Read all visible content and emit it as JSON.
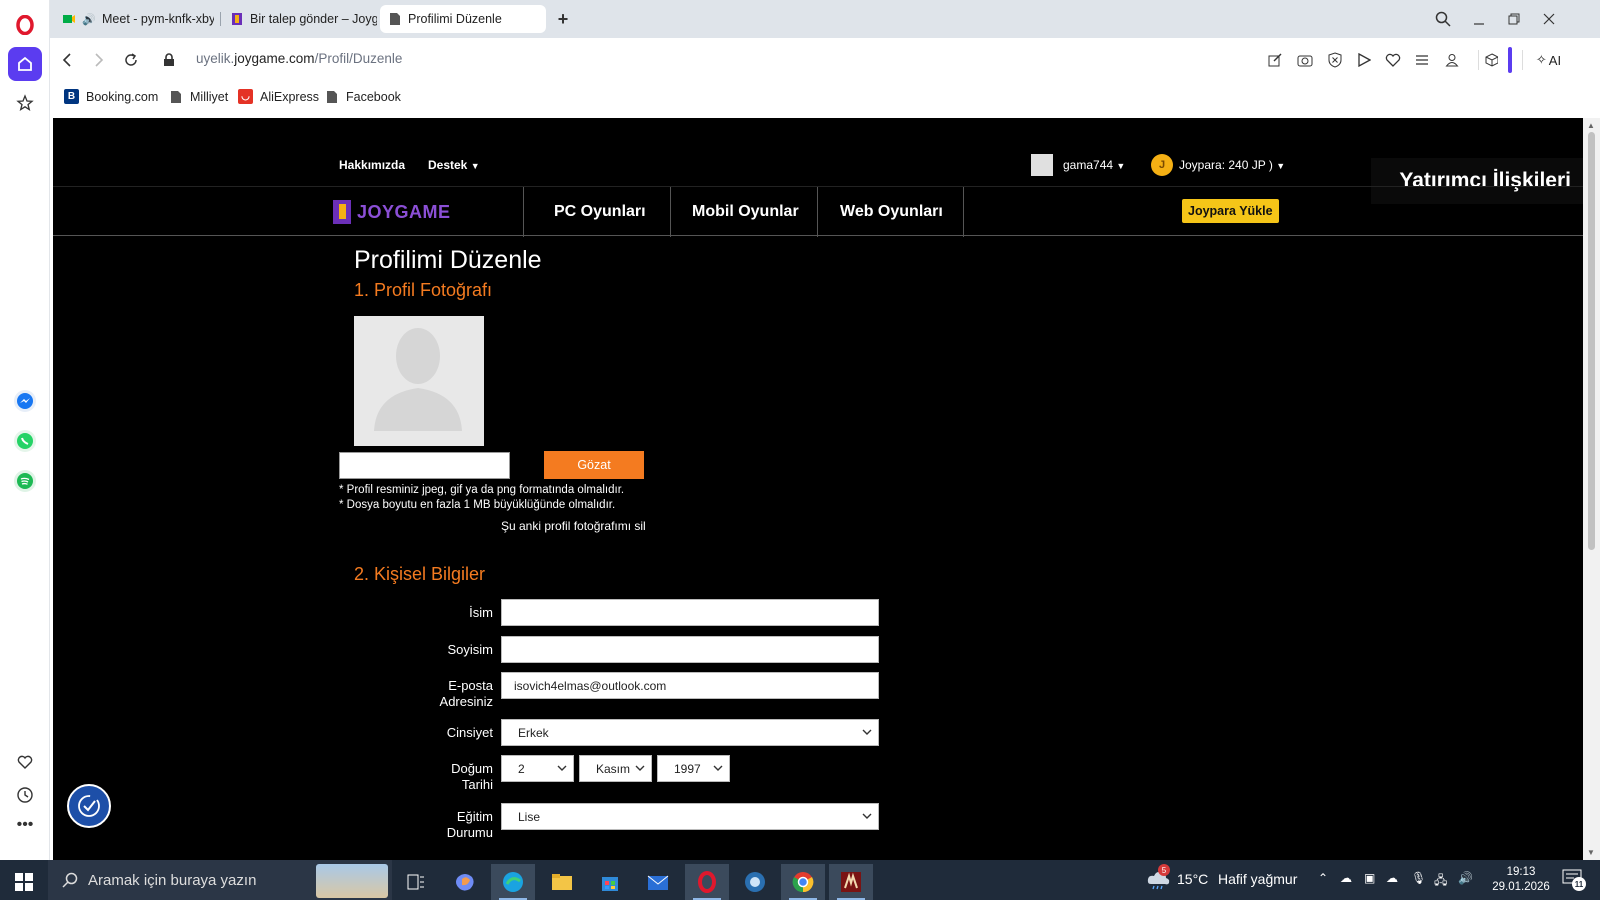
{
  "browser": {
    "tabs": [
      {
        "label": "Meet - pym-knfk-xby",
        "active": false
      },
      {
        "label": "Bir talep gönder – Joygam",
        "active": false
      },
      {
        "label": "Profilimi Düzenle",
        "active": true
      }
    ],
    "url_prefix": "uyelik.",
    "url_domain": "joygame.com",
    "url_path": "/Profil/Duzenle",
    "ai_label": "AI",
    "bookmarks": [
      {
        "label": "Booking.com",
        "icon": "booking-icon"
      },
      {
        "label": "Milliyet",
        "icon": "page-icon"
      },
      {
        "label": "AliExpress",
        "icon": "aliexpress-icon"
      },
      {
        "label": "Facebook",
        "icon": "page-icon"
      }
    ]
  },
  "site": {
    "top_links": {
      "about": "Hakkımızda",
      "support": "Destek"
    },
    "username": "gama744",
    "joypara": "Joypara: 240 JP )",
    "logo": "JOYGAME",
    "nav": [
      "PC Oyunları",
      "Mobil Oyunlar",
      "Web Oyunları"
    ],
    "load_button": "Joypara Yükle",
    "investor": "Yatırımcı İlişkileri",
    "accent": "#f47b20"
  },
  "profile": {
    "title": "Profilimi Düzenle",
    "section1": "1. Profil Fotoğrafı",
    "browse": "Gözat",
    "note1": "* Profil resminiz jpeg, gif ya da png formatında olmalıdır.",
    "note2": "* Dosya boyutu en fazla 1 MB büyüklüğünde olmalıdır.",
    "delete_photo": "Şu anki profil fotoğrafımı sil",
    "section2": "2. Kişisel Bilgiler",
    "fields": {
      "name_label": "İsim",
      "name_value": "",
      "surname_label": "Soyisim",
      "surname_value": "",
      "email_label_1": "E-posta",
      "email_label_2": "Adresiniz",
      "email_value": "isovich4elmas@outlook.com",
      "gender_label": "Cinsiyet",
      "gender_value": "Erkek",
      "birth_label_1": "Doğum",
      "birth_label_2": "Tarihi",
      "birth_day": "2",
      "birth_month": "Kasım",
      "birth_year": "1997",
      "education_label_1": "Eğitim",
      "education_label_2": "Durumu",
      "education_value": "Lise"
    }
  },
  "taskbar": {
    "search_placeholder": "Aramak için buraya yazın",
    "weather_temp": "15°C",
    "weather_desc": "Hafif yağmur",
    "time": "19:13",
    "date": "29.01.2026",
    "notification_count": "11",
    "weather_badge": "5"
  }
}
